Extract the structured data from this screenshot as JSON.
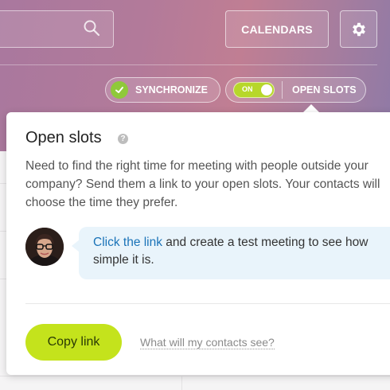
{
  "header": {
    "calendars_label": "CALENDARS",
    "synchronize_label": "SYNCHRONIZE",
    "open_slots_label": "OPEN SLOTS",
    "toggle_label": "ON",
    "toggle_on": true
  },
  "popup": {
    "title": "Open slots",
    "help_glyph": "?",
    "description": "Need to find the right time for meeting with people outside your\ncompany? Send them a link to your open slots. Your contacts will\nchoose the time they prefer.",
    "bubble_link": "Click the link",
    "bubble_text": " and create a test meeting to see how simple it is.",
    "copy_link_label": "Copy link",
    "contacts_link_label": "What will my contacts see?"
  },
  "icons": {
    "search": "search-icon",
    "settings": "gear-icon",
    "check": "check-icon",
    "help": "help-icon"
  },
  "colors": {
    "accent_green": "#c4e31c",
    "sync_check": "#8fc93a",
    "link_blue": "#1a73b8",
    "bubble_bg": "#e9f4fb"
  }
}
